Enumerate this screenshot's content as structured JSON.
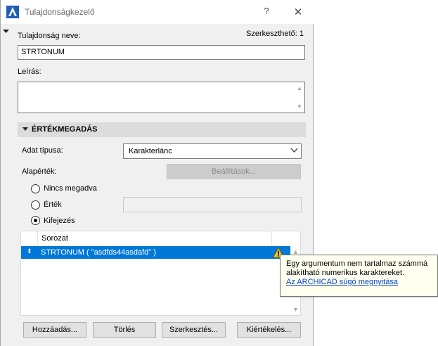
{
  "window": {
    "title": "Tulajdonságkezelő",
    "help_glyph": "?",
    "close_glyph": "✕"
  },
  "property": {
    "name_label": "Tulajdonság neve:",
    "editable_label": "Szerkeszthető: 1",
    "name_value": "STRTONUM",
    "description_label": "Leírás:",
    "description_value": ""
  },
  "section": {
    "title": "ÉRTÉKMEGADÁS"
  },
  "value_definition": {
    "data_type_label": "Adat típusa:",
    "data_type_value": "Karakterlánc",
    "default_label": "Alapérték:",
    "settings_button": "Beállítások...",
    "radio_none": "Nincs megadva",
    "radio_value": "Érték",
    "radio_expression": "Kifejezés",
    "selected_radio": "Kifejezés"
  },
  "list": {
    "header_series": "Sorozat",
    "rows": [
      {
        "text": "STRTONUM ( \"asdfds44asdafd\" )",
        "selected": true,
        "warning": true
      }
    ]
  },
  "buttons": {
    "add": "Hozzáadás...",
    "delete": "Törlés",
    "edit": "Szerkesztés...",
    "evaluate": "Kiértékelés..."
  },
  "tooltip": {
    "line1": "Egy argumentum nem tartalmaz számmá",
    "line2": "alakítható numerikus karaktereket.",
    "link": "Az ARCHICAD súgó megnyitása"
  },
  "colors": {
    "selection": "#0078d7",
    "warning": "#f5c518",
    "link": "#0645c9"
  }
}
